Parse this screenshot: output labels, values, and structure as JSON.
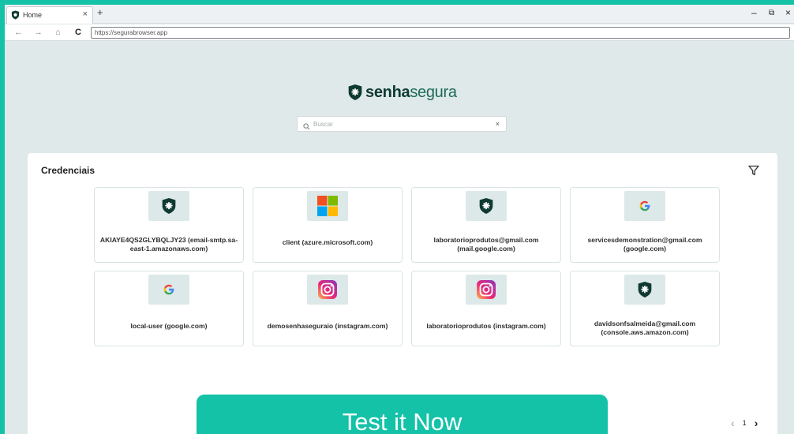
{
  "browser": {
    "tab_title": "Home",
    "tab_close": "×",
    "new_tab": "+",
    "url": "https://segurabrowser.app",
    "nav": {
      "back": "←",
      "forward": "→",
      "home": "⌂",
      "reload": "C"
    },
    "window_controls": {
      "minimize": "–",
      "restore": "⧉",
      "close": "×"
    }
  },
  "logo": {
    "part1": "senha",
    "part2": "segura"
  },
  "search": {
    "placeholder": "Buscar",
    "value": "",
    "clear": "×"
  },
  "credentials": {
    "title": "Credenciais",
    "cards": [
      {
        "label": "AKIAYE4QS2GLYBQLJY23 (email-smtp.sa-east-1.amazonaws.com)",
        "icon": "senhasegura-shield-icon"
      },
      {
        "label": "client (azure.microsoft.com)",
        "icon": "microsoft-icon"
      },
      {
        "label": "laboratorioprodutos@gmail.com (mail.google.com)",
        "icon": "senhasegura-shield-icon"
      },
      {
        "label": "servicesdemonstration@gmail.com (google.com)",
        "icon": "google-icon"
      },
      {
        "label": "local-user (google.com)",
        "icon": "google-icon"
      },
      {
        "label": "demosenhaseguraio (instagram.com)",
        "icon": "instagram-icon"
      },
      {
        "label": "laboratorioprodutos (instagram.com)",
        "icon": "instagram-icon"
      },
      {
        "label": "davidsonfsalmeida@gmail.com (console.aws.amazon.com)",
        "icon": "senhasegura-shield-icon"
      }
    ]
  },
  "pagination": {
    "prev": "‹",
    "current": "1",
    "next": "›"
  },
  "cta": {
    "label": "Test it Now"
  },
  "colors": {
    "accent": "#14c2a8",
    "brand_dark": "#0f3a32",
    "page_bg": "#dfe9ea"
  }
}
